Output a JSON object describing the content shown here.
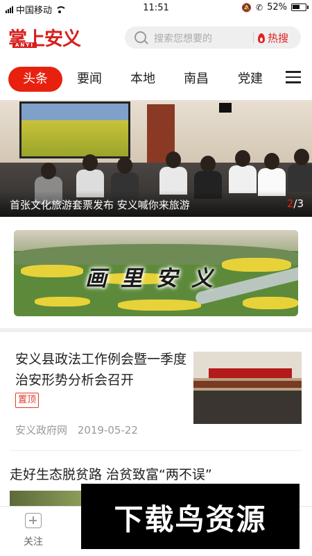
{
  "status_bar": {
    "carrier": "中国移动",
    "time": "11:51",
    "battery": "52%"
  },
  "header": {
    "logo_text": "掌上安义",
    "logo_sub": "ANYI",
    "search_placeholder": "搜索您想要的",
    "hot_search_label": "热搜"
  },
  "tabs": [
    {
      "label": "头条",
      "active": true
    },
    {
      "label": "要闻",
      "active": false
    },
    {
      "label": "本地",
      "active": false
    },
    {
      "label": "南昌",
      "active": false
    },
    {
      "label": "党建",
      "active": false
    }
  ],
  "carousel": {
    "caption": "首张文化旅游套票发布 安义喊你来旅游",
    "current": "2",
    "total": "/3"
  },
  "banner": {
    "title": "画里安义"
  },
  "news": [
    {
      "title": "安义县政法工作例会暨一季度治安形势分析会召开",
      "badge": "置顶",
      "source": "安义政府网",
      "date": "2019-05-22"
    },
    {
      "title": "走好生态脱贫路 治贫致富“两不误”"
    }
  ],
  "bottom_nav": {
    "follow_label": "关注"
  },
  "watermark": {
    "text": "下载鸟资源"
  },
  "colors": {
    "accent": "#e8210f",
    "logo_red": "#d81e1e"
  }
}
